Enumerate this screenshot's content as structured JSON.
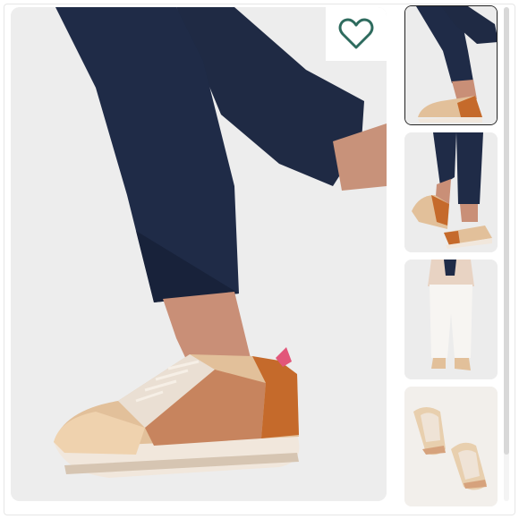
{
  "gallery": {
    "favorite_icon": "heart-outline-icon",
    "accent_color": "#2e6b5e",
    "main_image": {
      "description_icon": "product-photo",
      "selected_index": 0
    },
    "thumbnails": [
      {
        "name": "thumbnail-side-view-walking",
        "selected": true
      },
      {
        "name": "thumbnail-pair-on-feet",
        "selected": false
      },
      {
        "name": "thumbnail-full-outfit",
        "selected": false
      },
      {
        "name": "thumbnail-top-view-pair",
        "selected": false
      }
    ]
  }
}
